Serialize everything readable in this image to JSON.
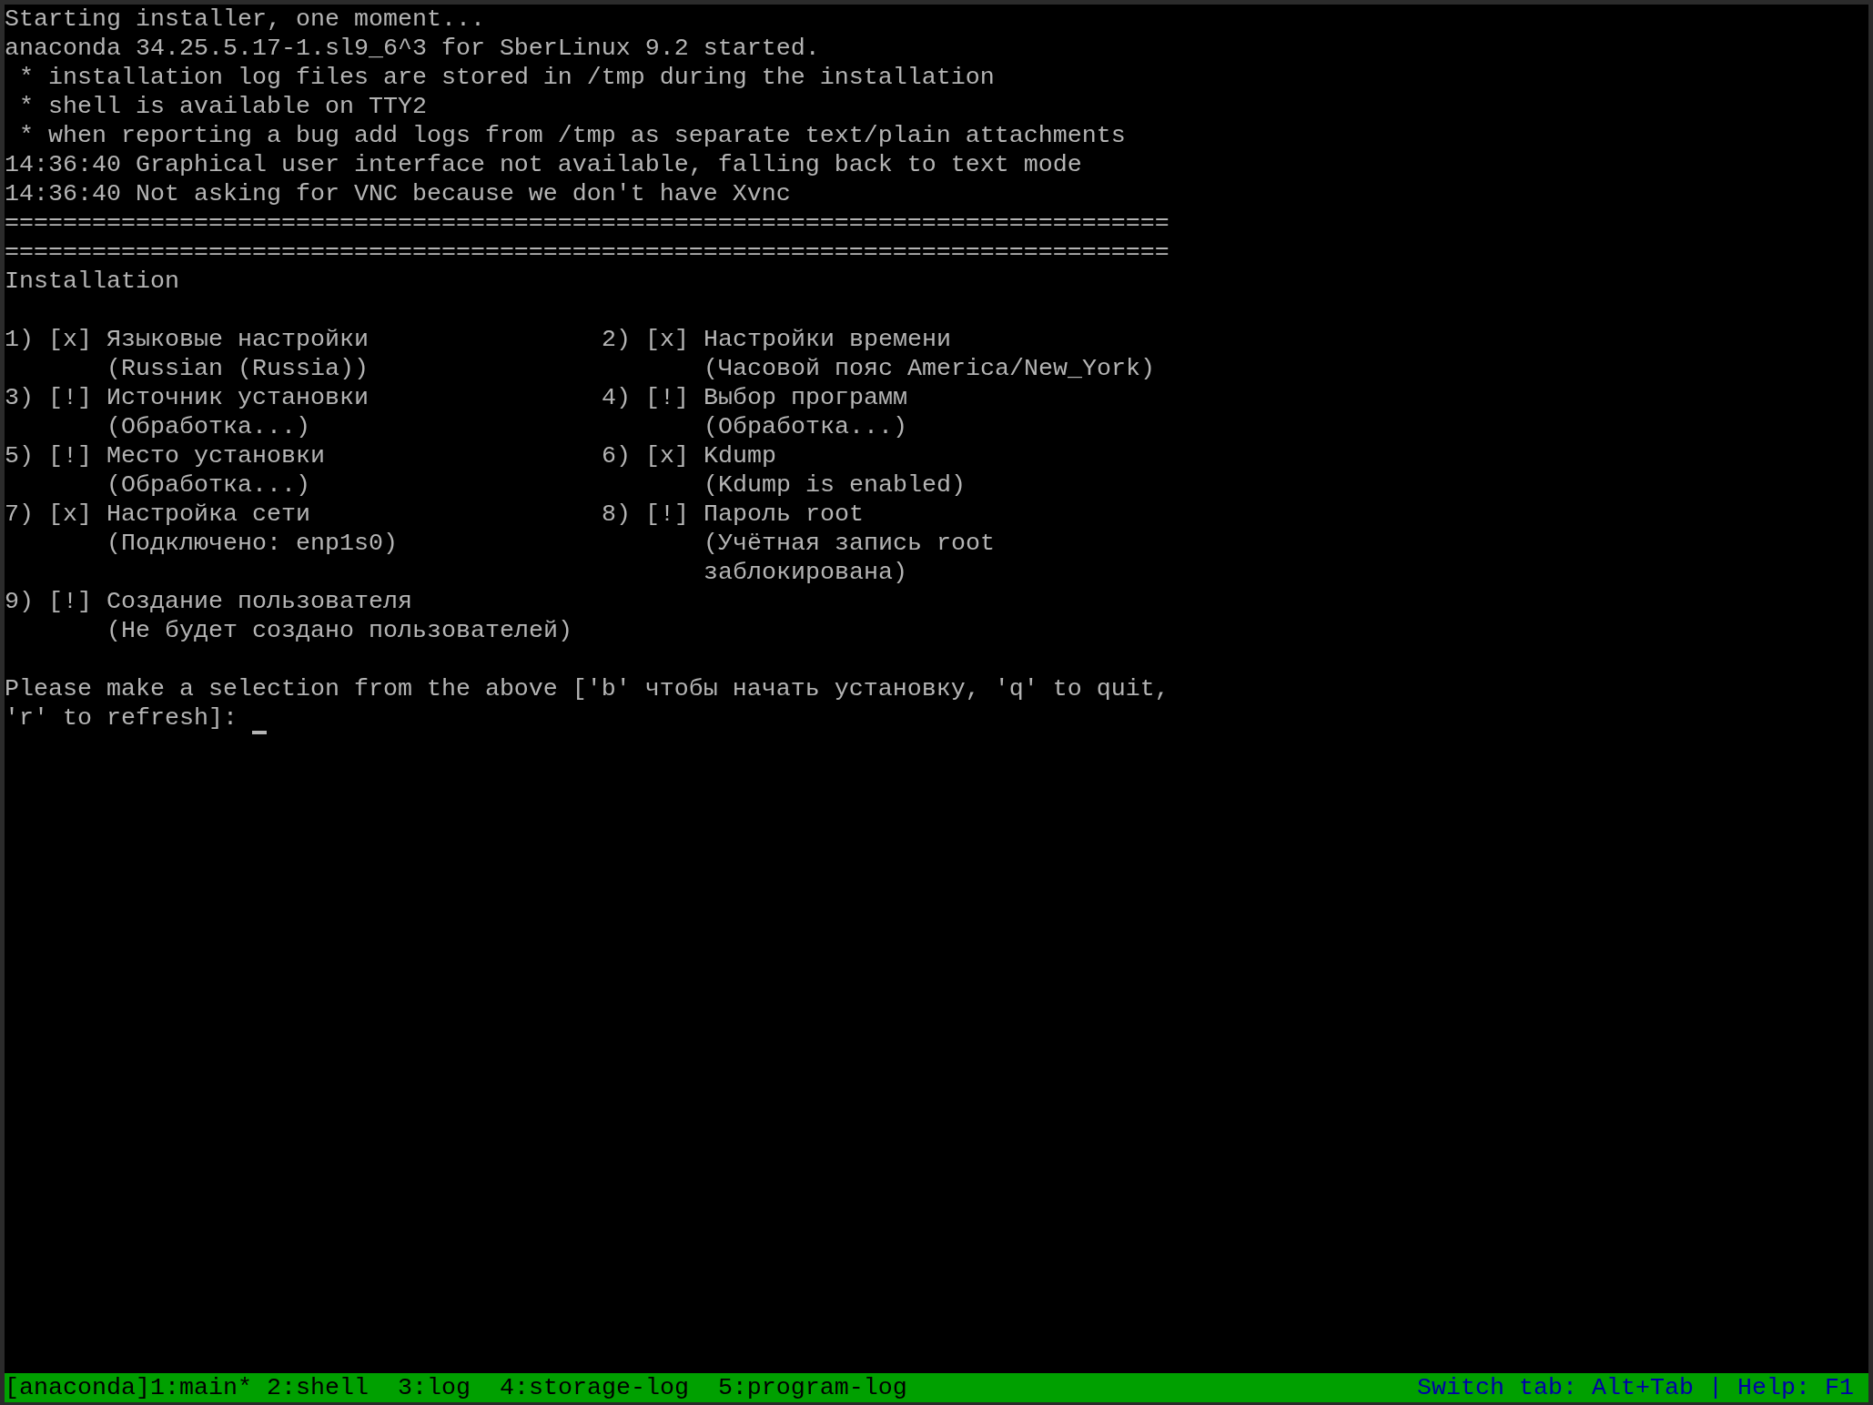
{
  "boot_log": [
    {
      "kind": "plain",
      "text": "Starting installer, one moment..."
    },
    {
      "kind": "plain",
      "text": "anaconda 34.25.5.17-1.sl9_6^3 for SberLinux 9.2 started."
    },
    {
      "kind": "indented",
      "text": "* installation log files are stored in /tmp during the installation"
    },
    {
      "kind": "indented",
      "text": "* shell is available on TTY2"
    },
    {
      "kind": "indented",
      "text": "* when reporting a bug add logs from /tmp as separate text/plain attachments"
    },
    {
      "kind": "plain",
      "text": "14:36:40 Graphical user interface not available, falling back to text mode"
    },
    {
      "kind": "plain",
      "text": "14:36:40 Not asking for VNC because we don't have Xvnc"
    }
  ],
  "separators": [
    "================================================================================",
    "================================================================================"
  ],
  "hub": {
    "title": "Installation",
    "spokes": [
      {
        "number": "1)",
        "status": "[x]",
        "title": "Языковые настройки",
        "detail": "(Russian (Russia))"
      },
      {
        "number": "2)",
        "status": "[x]",
        "title": "Настройки времени",
        "detail": "(Часовой пояс America/New_York)"
      },
      {
        "number": "3)",
        "status": "[!]",
        "title": "Источник установки",
        "detail": "(Обработка...)"
      },
      {
        "number": "4)",
        "status": "[!]",
        "title": "Выбор программ",
        "detail": "(Обработка...)"
      },
      {
        "number": "5)",
        "status": "[!]",
        "title": "Место установки",
        "detail": "(Обработка...)"
      },
      {
        "number": "6)",
        "status": "[x]",
        "title": "Kdump",
        "detail": "(Kdump is enabled)"
      },
      {
        "number": "7)",
        "status": "[x]",
        "title": "Настройка сети",
        "detail": "(Подключено: enp1s0)"
      },
      {
        "number": "8)",
        "status": "[!]",
        "title": "Пароль root",
        "detail": "(Учётная запись root заблокирована)"
      },
      {
        "number": "9)",
        "status": "[!]",
        "title": "Создание пользователя",
        "detail": "(Не будет создано пользователей)"
      }
    ]
  },
  "prompt": {
    "text": "Please make a selection from the above ['b' чтобы начать установку, 'q' to quit, 'r' to refresh]:"
  },
  "status_bar": {
    "session": "[anaconda]",
    "tabs": [
      "1:main*",
      "2:shell",
      "3:log",
      "4:storage-log",
      "5:program-log"
    ],
    "hint": "Switch tab: Alt+Tab | Help: F1"
  }
}
